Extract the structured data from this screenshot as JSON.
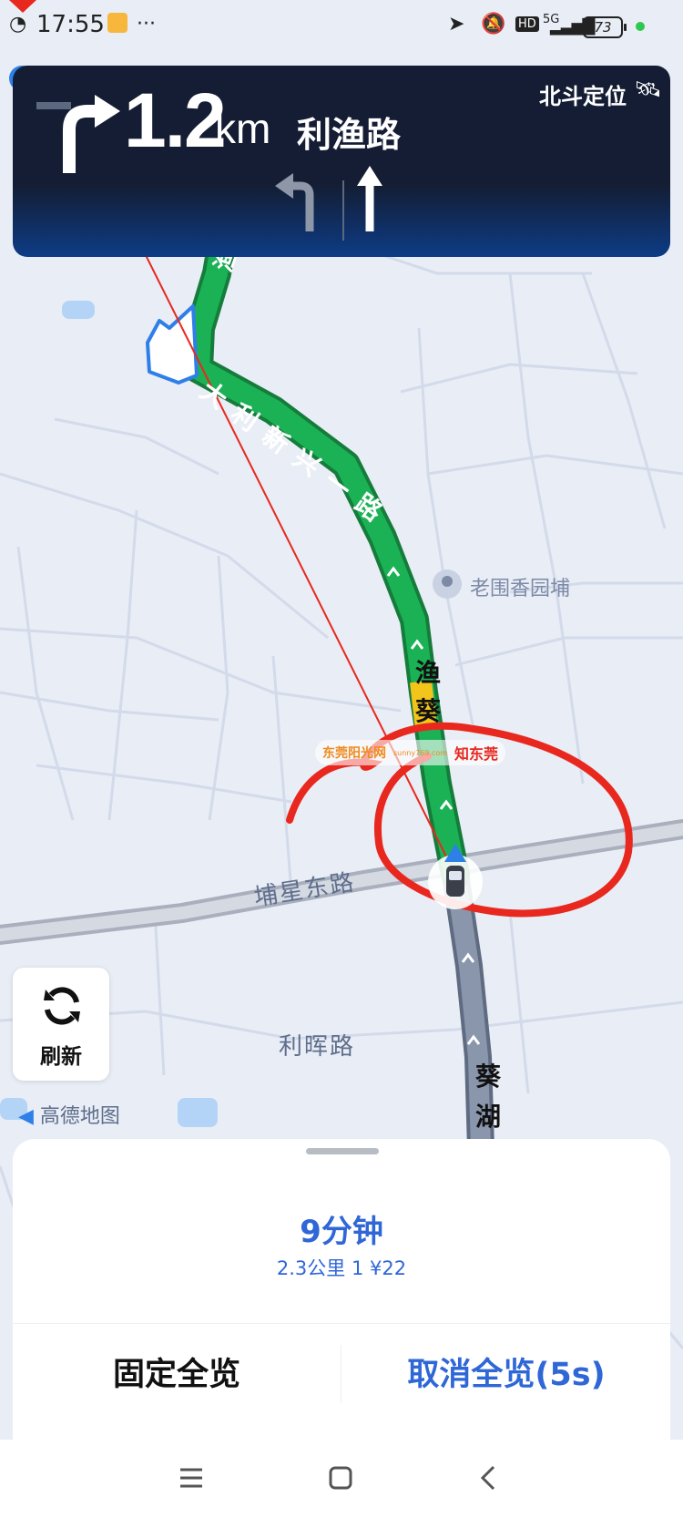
{
  "status_bar": {
    "time": "17:55",
    "network": "5G",
    "hd": "HD",
    "battery": "73"
  },
  "nav_panel": {
    "distance_value": "1.2",
    "distance_unit": "km",
    "road_name": "利渔路",
    "positioning_label": "北斗定位",
    "turn_icon": "turn-right-arrow",
    "lanes": [
      "turn-left",
      "straight"
    ]
  },
  "map": {
    "route_label_1": "大利新兴一路",
    "route_label_2": "渔葵",
    "route_label_3": "葵湖",
    "route_label_top": "渔路",
    "poi": "老围香园埔",
    "road_pubu": "埔星东路",
    "road_lihui": "利晖路",
    "watermark_1": "东莞阳光网",
    "watermark_1_sub": "sunny769.com",
    "watermark_2": "知东莞",
    "route_color": "#1bb255",
    "annotation_color": "#e8281e"
  },
  "refresh_button": {
    "label": "刷新"
  },
  "map_logo": {
    "text": "高德地图"
  },
  "bottom_sheet": {
    "eta": "9分钟",
    "info": "2.3公里  1 ¥22",
    "fixed_overview": "固定全览",
    "cancel_overview": "取消全览(5s)"
  },
  "colors": {
    "panel_bg": "#141d33",
    "accent": "#2f67d7",
    "map_bg": "#e9edf6"
  }
}
